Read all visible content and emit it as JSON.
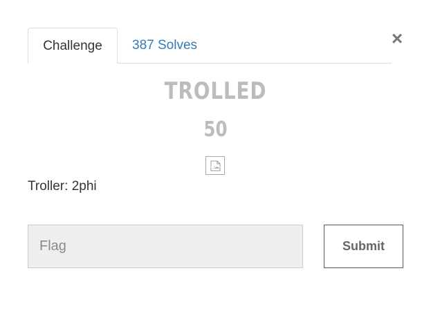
{
  "modal": {
    "close_label": "×",
    "tabs": [
      {
        "label": "Challenge"
      },
      {
        "label": "387 Solves"
      }
    ],
    "challenge": {
      "name": "TROLLED",
      "value": "50",
      "image_icon": "broken-image-icon",
      "description": "Troller: 2phi"
    },
    "flag_form": {
      "placeholder": "Flag",
      "value": "",
      "submit_label": "Submit"
    }
  },
  "colors": {
    "link": "#337ab7",
    "title_gray": "#bcbcbc",
    "input_bg": "#efefef"
  }
}
